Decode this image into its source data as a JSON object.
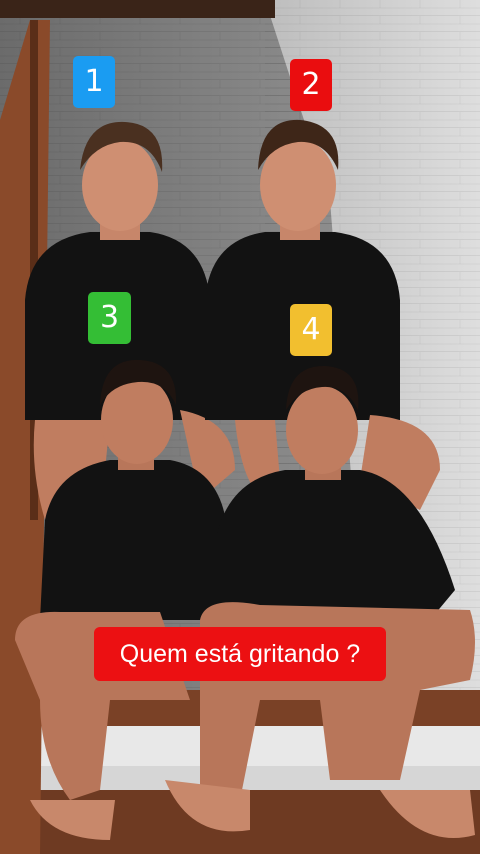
{
  "badges": [
    {
      "number": "1",
      "color": "#1a9cf2"
    },
    {
      "number": "2",
      "color": "#ea0d0f"
    },
    {
      "number": "3",
      "color": "#34be35"
    },
    {
      "number": "4",
      "color": "#f2bf2f"
    }
  ],
  "caption": {
    "text": "Quem está gritando ?",
    "color": "#ec1012"
  },
  "photo": {
    "subject_count": 4,
    "palette": {
      "wall": "#d9d9d9",
      "shirt": "#111111",
      "skin": "#c9876a",
      "stairs": "#8a4a2a"
    }
  }
}
